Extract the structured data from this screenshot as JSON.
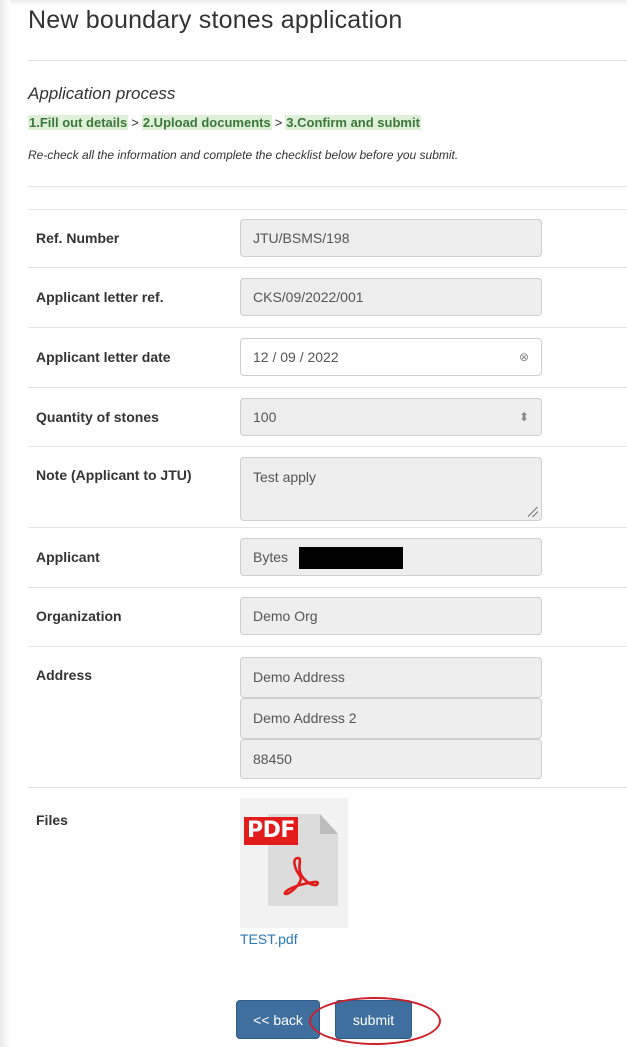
{
  "page": {
    "title": "New boundary stones application"
  },
  "process": {
    "title": "Application process",
    "steps": [
      "1.Fill out details",
      "2.Upload documents",
      "3.Confirm and submit"
    ],
    "separator": ">",
    "instruction": "Re-check all the information and complete the checklist below before you submit."
  },
  "fields": {
    "ref_number": {
      "label": "Ref. Number",
      "value": "JTU/BSMS/198"
    },
    "letter_ref": {
      "label": "Applicant letter ref.",
      "value": "CKS/09/2022/001"
    },
    "letter_date": {
      "label": "Applicant letter date",
      "value": "12 / 09 / 2022"
    },
    "quantity": {
      "label": "Quantity of stones",
      "value": "100"
    },
    "note": {
      "label": "Note (Applicant to JTU)",
      "value": "Test apply"
    },
    "applicant": {
      "label": "Applicant",
      "value": "Bytes"
    },
    "organization": {
      "label": "Organization",
      "value": "Demo Org"
    },
    "address": {
      "label": "Address",
      "line1": "Demo Address",
      "line2": "Demo Address 2",
      "postcode": "88450"
    }
  },
  "files": {
    "label": "Files",
    "items": [
      {
        "name": "TEST.pdf",
        "icon": "pdf-file-icon",
        "badge": "PDF"
      }
    ]
  },
  "actions": {
    "back_label": "<< back",
    "submit_label": "submit"
  },
  "colors": {
    "step_bg": "#dff0d8",
    "step_text": "#3c763d",
    "button": "#3f6f9e",
    "annotation_ring": "#cc1f2a",
    "pdf_red": "#e21b1b"
  }
}
